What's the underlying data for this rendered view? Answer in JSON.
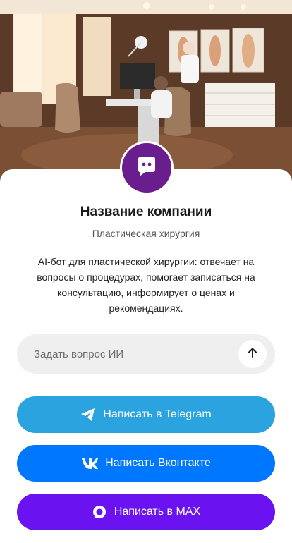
{
  "hero": {
    "image": "plastic-surgery-clinic-office-photo"
  },
  "avatar": {
    "icon": "chat-bot-icon",
    "color": "#6a1e8e"
  },
  "company": {
    "name": "Название компании",
    "category": "Пластическая хирургия",
    "description": "AI-бот для пластической хирургии: отвечает на вопросы о процедурах, помогает записаться на консультацию, информирует о ценах и рекомендациях."
  },
  "ask": {
    "placeholder": "Задать вопрос ИИ",
    "send_icon": "arrow-up-icon"
  },
  "buttons": {
    "telegram": {
      "label": "Написать в Telegram",
      "icon": "telegram-icon",
      "color": "#2aa3df"
    },
    "vk": {
      "label": "Написать Вконтакте",
      "icon": "vk-icon",
      "color": "#0077ff"
    },
    "max": {
      "label": "Написать в MAX",
      "icon": "max-icon",
      "color": "#6b12f0"
    }
  }
}
